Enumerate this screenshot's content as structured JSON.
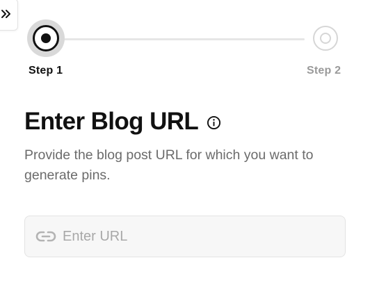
{
  "sidebar_toggle": {
    "icon": "double-chevron-right-icon"
  },
  "stepper": {
    "steps": [
      {
        "label": "Step 1",
        "state": "active"
      },
      {
        "label": "Step 2",
        "state": "inactive"
      }
    ],
    "colors": {
      "active": "#111111",
      "inactive": "#d6d6d6",
      "line": "#e6e6e6"
    }
  },
  "heading": {
    "title": "Enter Blog URL",
    "info_icon": "info-icon"
  },
  "description": "Provide the blog post URL for which you want to generate pins.",
  "url_input": {
    "placeholder": "Enter URL",
    "value": "",
    "icon": "link-icon"
  }
}
